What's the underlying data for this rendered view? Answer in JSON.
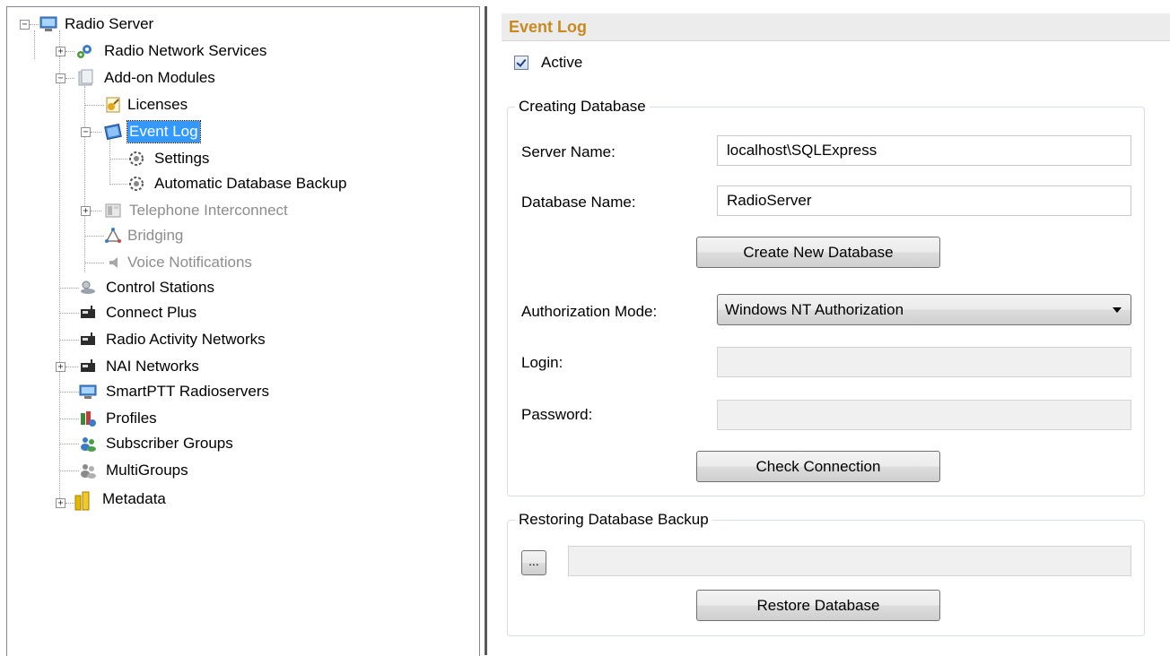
{
  "tree": {
    "root": "Radio Server",
    "items": [
      {
        "label": "Radio Network Services",
        "icon": "gear-network-icon"
      },
      {
        "label": "Add-on Modules",
        "icon": "modules-icon"
      },
      {
        "label": "Licenses",
        "icon": "license-icon"
      },
      {
        "label": "Event Log",
        "icon": "event-log-icon"
      },
      {
        "label": "Settings",
        "icon": "gear-icon"
      },
      {
        "label": "Automatic Database Backup",
        "icon": "gear-icon"
      },
      {
        "label": "Telephone Interconnect",
        "icon": "telephone-icon"
      },
      {
        "label": "Bridging",
        "icon": "bridging-icon"
      },
      {
        "label": "Voice Notifications",
        "icon": "speaker-icon"
      },
      {
        "label": "Control Stations",
        "icon": "control-station-icon"
      },
      {
        "label": "Connect Plus",
        "icon": "radio-icon"
      },
      {
        "label": "Radio Activity Networks",
        "icon": "radio-icon"
      },
      {
        "label": "NAI Networks",
        "icon": "radio-icon"
      },
      {
        "label": "SmartPTT Radioservers",
        "icon": "computer-icon"
      },
      {
        "label": "Profiles",
        "icon": "profiles-icon"
      },
      {
        "label": "Subscriber Groups",
        "icon": "users-icon"
      },
      {
        "label": "MultiGroups",
        "icon": "multigroups-icon"
      },
      {
        "label": "Metadata",
        "icon": "database-icon"
      }
    ]
  },
  "panel": {
    "title": "Event Log",
    "active_label": "Active",
    "active_checked": true,
    "creating": {
      "legend": "Creating Database",
      "server_name_label": "Server Name:",
      "server_name_value": "localhost\\SQLExpress",
      "database_name_label": "Database Name:",
      "database_name_value": "RadioServer",
      "create_button": "Create New Database",
      "auth_mode_label": "Authorization Mode:",
      "auth_mode_value": "Windows NT Authorization",
      "login_label": "Login:",
      "login_value": "",
      "password_label": "Password:",
      "password_value": "",
      "check_button": "Check Connection"
    },
    "restoring": {
      "legend": "Restoring Database Backup",
      "browse_button": "...",
      "path_value": "",
      "restore_button": "Restore Database"
    }
  },
  "colors": {
    "title": "#c88a20",
    "selection": "#3399ff",
    "disabled_text": "#8d8d8d"
  }
}
